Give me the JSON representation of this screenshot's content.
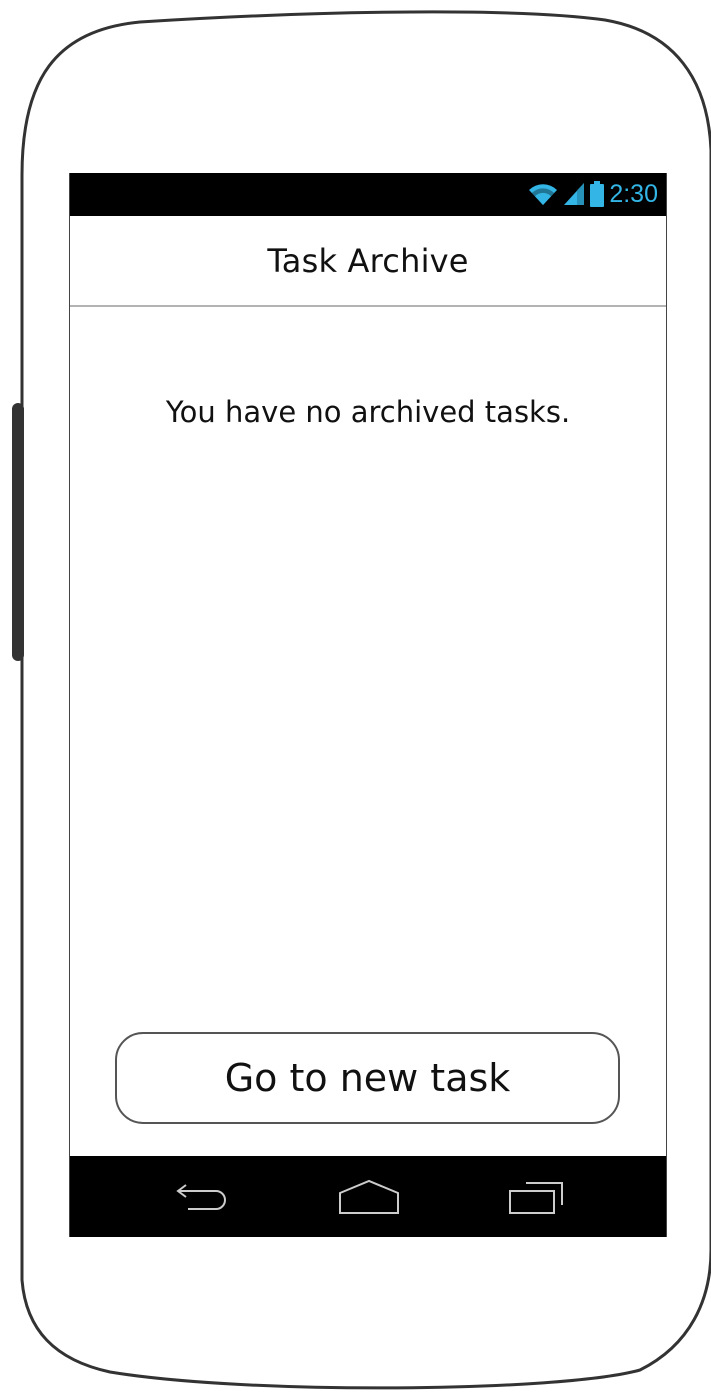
{
  "status_bar": {
    "time": "2:30",
    "time_color": "#33b5e5",
    "icons": [
      "wifi-icon",
      "cell-signal-icon",
      "battery-icon"
    ]
  },
  "header": {
    "title": "Task Archive"
  },
  "main": {
    "empty_message": "You have no archived tasks."
  },
  "actions": {
    "primary_button_label": "Go to new task"
  },
  "nav_bar": {
    "buttons": [
      "back-icon",
      "home-icon",
      "recent-apps-icon"
    ]
  }
}
